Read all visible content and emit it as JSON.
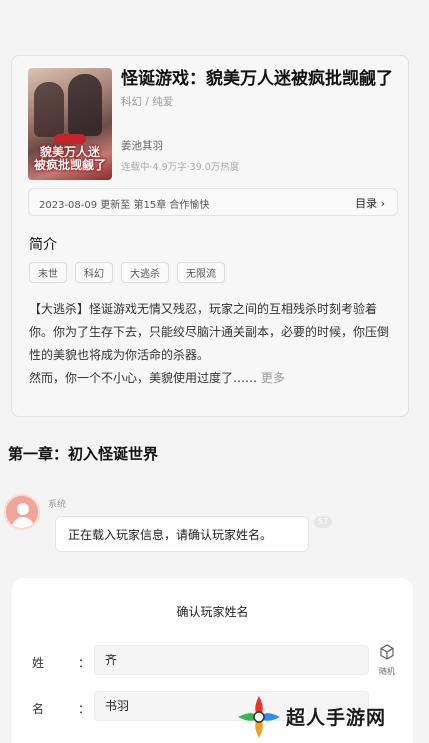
{
  "book": {
    "cover_text": "貌美万人迷\n被疯批觊觎了",
    "title": "怪诞游戏：貌美万人迷被疯批觊觎了",
    "genre": "科幻 / 纯爱",
    "author": "姜池其羽",
    "stats": "连载中·4.9万字·39.0万热度",
    "update_text": "2023-08-09  更新至 第15章 合作愉快",
    "toc_label": "目录 ›",
    "intro_title": "简介",
    "tags": [
      "末世",
      "科幻",
      "大逃杀",
      "无限流"
    ],
    "description": "【大逃杀】怪诞游戏无情又残忍，玩家之间的互相残杀时刻考验着你。你为了生存下去，只能绞尽脑汁通关副本，必要的时候，你压倒性的美貌也将成为你活命的杀器。\n然而，你一个不小心，美貌使用过度了……",
    "more_label": "更多"
  },
  "chapter": {
    "title": "第一章：初入怪诞世界",
    "sender": "系统",
    "message": "正在载入玩家信息，请确认玩家姓名。",
    "badge": "57"
  },
  "form": {
    "title": "确认玩家姓名",
    "surname_label": "姓",
    "surname_value": "齐",
    "given_label": "名",
    "given_value": "书羽",
    "colon": "：",
    "random_label": "随机"
  },
  "watermark": {
    "text": "超人手游网"
  }
}
